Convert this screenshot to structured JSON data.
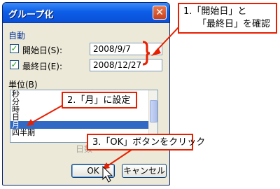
{
  "dialog": {
    "title": "グループ化",
    "close_label": "✕"
  },
  "auto_section": {
    "label": "自動",
    "start": {
      "checked": true,
      "label": "開始日(S):",
      "value": "2008/9/7"
    },
    "end": {
      "checked": true,
      "label": "最終日(E):",
      "value": "2008/12/27"
    }
  },
  "unit_section": {
    "label": "単位(B)",
    "items": [
      "秒",
      "分",
      "時",
      "日",
      "月",
      "四半期"
    ],
    "selected": "月"
  },
  "days_label": "日数",
  "buttons": {
    "ok": "OK",
    "cancel": "キャンセル"
  },
  "annotations": {
    "note1_line1": "1.「開始日」と",
    "note1_line2": "「最終日」を確認",
    "note2": "2.「月」に設定",
    "note3": "3.「OK」ボタンをクリック",
    "accent_color": "#e82000"
  }
}
